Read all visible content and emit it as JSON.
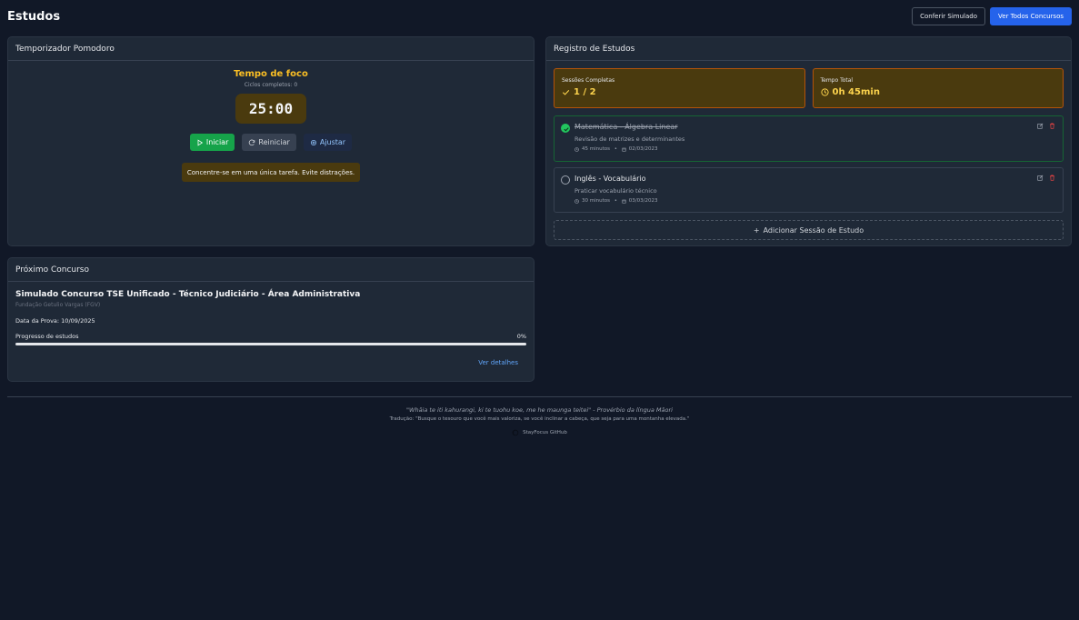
{
  "header": {
    "title": "Estudos",
    "btn_simulado": "Conferir Simulado",
    "btn_concursos": "Ver Todos Concursos"
  },
  "pomodoro": {
    "title": "Temporizador Pomodoro",
    "mode": "Tempo de foco",
    "cycles": "Ciclos completos: 0",
    "time": "25:00",
    "btn_start": "Iniciar",
    "btn_reset": "Reiniciar",
    "btn_adjust": "Ajustar",
    "tip": "Concentre-se em uma única tarefa. Evite distrações."
  },
  "registro": {
    "title": "Registro de Estudos",
    "stat_sessions_label": "Sessões Completas",
    "stat_sessions_value": "1 / 2",
    "stat_time_label": "Tempo Total",
    "stat_time_value": "0h 45min",
    "sessions": [
      {
        "title": "Matemática - Álgebra Linear",
        "description": "Revisão de matrizes e determinantes",
        "duration": "45 minutos",
        "date": "02/03/2023",
        "completed": true
      },
      {
        "title": "Inglês - Vocabulário",
        "description": "Praticar vocabulário técnico",
        "duration": "30 minutos",
        "date": "03/03/2023",
        "completed": false
      }
    ],
    "add_label": "Adicionar Sessão de Estudo"
  },
  "concurso": {
    "title": "Próximo Concurso",
    "name": "Simulado Concurso TSE Unificado - Técnico Judiciário - Área Administrativa",
    "org": "Fundação Getulio Vargas (FGV)",
    "date_label": "Data da Prova:",
    "date_value": "10/09/2025",
    "progress_label": "Progresso de estudos",
    "progress_value": "0%",
    "progress_fraction": 0,
    "link": "Ver detalhes"
  },
  "footer": {
    "quote": "\"Whāia te iti kahurangi, ki te tuohu koe, me he maunga teitei\" - Provérbio da língua Māori",
    "translation": "Tradução: \"Busque o tesouro que você mais valoriza, se você inclinar a cabeça, que seja para uma montanha elevada.\"",
    "github": "StayFocus GitHub"
  },
  "colors": {
    "background": "#111827",
    "card": "#1f2937",
    "accent_yellow": "#fbbf24",
    "primary_blue": "#2563eb",
    "success_green": "#16a34a"
  }
}
